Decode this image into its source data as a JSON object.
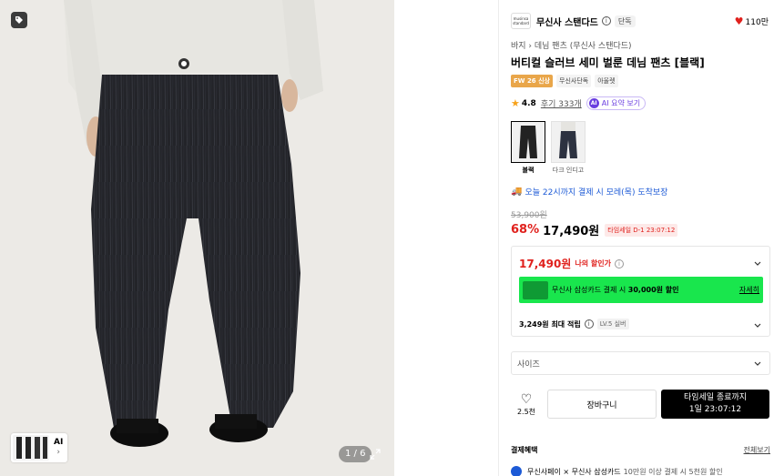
{
  "gallery": {
    "counter": "1 / 6",
    "thumb_ai_label": "AI",
    "thumb_ai_arrow": "›"
  },
  "brand": {
    "logo_text": "musinsa standard",
    "name": "무신사 스탠다드",
    "exclusive": "단독",
    "likes": "110만"
  },
  "breadcrumb": "바지 › 데님 팬츠 (무신사 스탠다드)",
  "product": {
    "title": "버티컬 슬러브 세미 벌룬 데님 팬츠 [블랙]",
    "badges": [
      "FW 26 신상",
      "무신사단독",
      "아울렛"
    ]
  },
  "rating": {
    "score": "4.8",
    "reviews": "후기 333개",
    "ai_summary": "AI 요약 보기",
    "ai_icon": "AI"
  },
  "colors": [
    {
      "label": "블랙",
      "selected": true
    },
    {
      "label": "다크 인디고",
      "selected": false
    }
  ],
  "delivery": "오늘 22시까지 결제 시 모레(목) 도착보장",
  "price": {
    "original": "53,900원",
    "discount": "68%",
    "final": "17,490원",
    "timesale": "타임세일 D-1 23:07:12"
  },
  "my_price": {
    "value": "17,490원",
    "label": "나의 할인가"
  },
  "card_banner": {
    "text_prefix": "무신사 삼성카드 결제 시 ",
    "text_bold": "30,000원 할인",
    "more": "자세히"
  },
  "points": {
    "text": "3,249원 최대 적립",
    "level": "LV.5 실버"
  },
  "size_select": {
    "placeholder": "사이즈"
  },
  "actions": {
    "wish_count": "2.5천",
    "cart": "장바구니",
    "buy_line1": "타임세일 종료까지",
    "buy_line2": "1일 23:07:12"
  },
  "benefits": {
    "title": "결제혜택",
    "all": "전체보기",
    "item_main": "무신사페이 × 무신사 삼성카드",
    "item_sub": "10만원 이상 결제 시 5천원 할인"
  },
  "colors_theme": {
    "accent_red": "#e0211d",
    "banner_green": "#19e64d",
    "link_blue": "#1c5ad6"
  }
}
